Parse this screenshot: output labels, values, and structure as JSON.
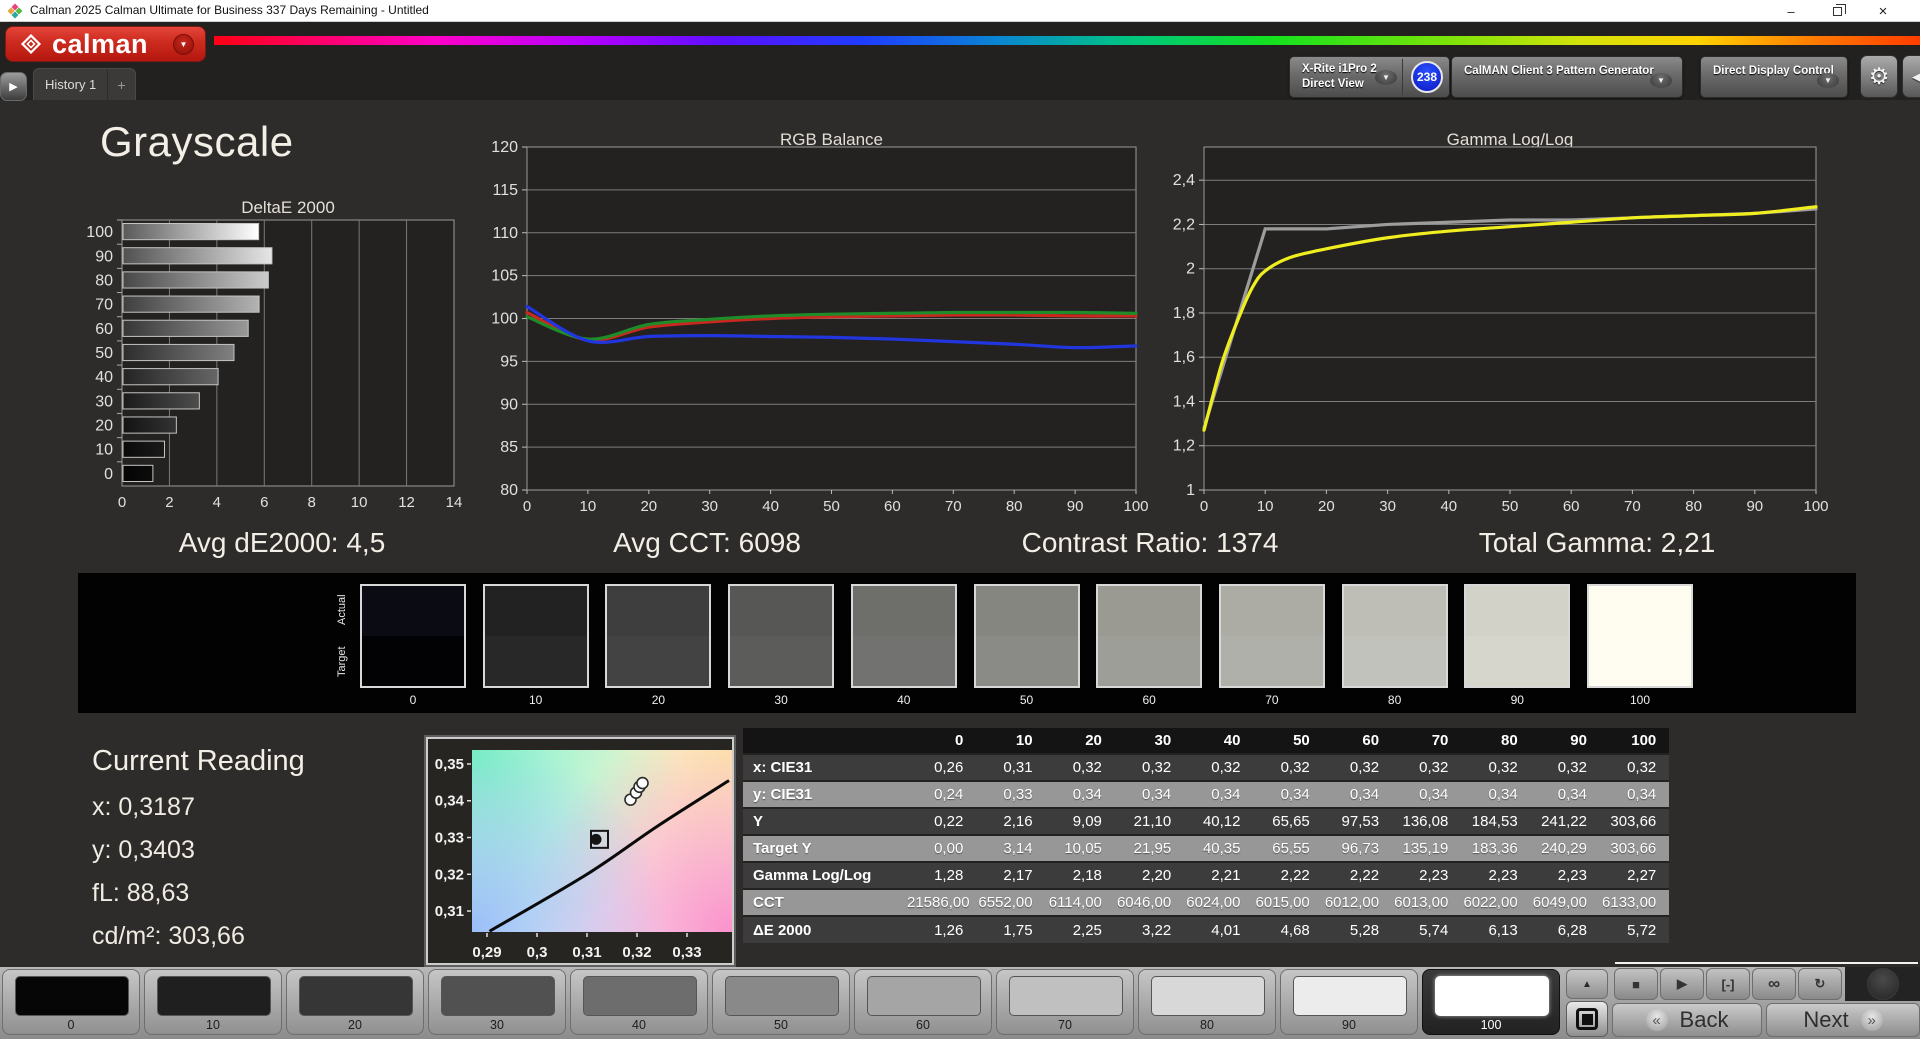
{
  "window": {
    "title": "Calman 2025 Calman Ultimate for Business 337 Days Remaining  - Untitled",
    "controls": {
      "minimize": "–",
      "close": "×"
    }
  },
  "icons": {
    "gear": "⚙",
    "collapse_right": "◀",
    "expand": "▶",
    "dropdown": "▼",
    "up": "▲",
    "back_chevron": "«",
    "next_chevron": "»",
    "plus": "+"
  },
  "header": {
    "logo_text": "calman",
    "tab_label": "History 1",
    "meters": [
      {
        "line1": "X-Rite i1Pro 2",
        "line2": "Direct View",
        "accent": "#35d435",
        "badge": "238"
      },
      {
        "line1": "CalMAN Client 3 Pattern Generator",
        "accent": "#35d435"
      },
      {
        "line1": "Direct Display Control",
        "accent": "#ecec2c"
      }
    ]
  },
  "page": {
    "title": "Grayscale"
  },
  "chart_data": [
    {
      "id": "deltae",
      "type": "bar",
      "orientation": "horizontal",
      "title": "DeltaE 2000",
      "categories": [
        100,
        90,
        80,
        70,
        60,
        50,
        40,
        30,
        20,
        10,
        0
      ],
      "values": [
        5.72,
        6.28,
        6.13,
        5.74,
        5.28,
        4.68,
        4.01,
        3.22,
        2.25,
        1.75,
        1.26
      ],
      "xlim": [
        0,
        14
      ],
      "xticks": [
        0,
        2,
        4,
        6,
        8,
        10,
        12,
        14
      ],
      "grid": "vertical"
    },
    {
      "id": "rgb",
      "type": "line",
      "title": "RGB Balance",
      "x": [
        0,
        10,
        20,
        30,
        40,
        50,
        60,
        70,
        80,
        90,
        100
      ],
      "series": [
        {
          "name": "red-balance",
          "color": "#c8281e",
          "values": [
            100.7,
            97.5,
            99.0,
            99.6,
            100.0,
            100.2,
            100.3,
            100.4,
            100.4,
            100.3,
            100.3
          ]
        },
        {
          "name": "green-balance",
          "color": "#1e8c28",
          "values": [
            100.2,
            97.6,
            99.3,
            99.9,
            100.3,
            100.5,
            100.6,
            100.7,
            100.7,
            100.7,
            100.6
          ]
        },
        {
          "name": "blue-balance",
          "color": "#2236e0",
          "values": [
            101.4,
            97.4,
            97.9,
            98.0,
            97.9,
            97.8,
            97.6,
            97.3,
            97.0,
            96.6,
            96.8
          ]
        }
      ],
      "ylim": [
        80,
        120
      ],
      "yticks": [
        80,
        85,
        90,
        95,
        100,
        105,
        110,
        115,
        120
      ],
      "xticks": [
        0,
        10,
        20,
        30,
        40,
        50,
        60,
        70,
        80,
        90,
        100
      ],
      "grid": "horizontal"
    },
    {
      "id": "gamma",
      "type": "line",
      "title": "Gamma Log/Log",
      "series": [
        {
          "name": "point-gamma",
          "color": "#9c9c9c",
          "smooth": false,
          "x": [
            0,
            10,
            20,
            30,
            40,
            50,
            60,
            70,
            80,
            90,
            100
          ],
          "values": [
            1.28,
            2.18,
            2.18,
            2.2,
            2.21,
            2.22,
            2.22,
            2.23,
            2.24,
            2.25,
            2.27
          ]
        },
        {
          "name": "measured-gamma",
          "color": "#f0ee1e",
          "x": [
            0,
            3,
            6,
            8,
            10,
            14,
            20,
            30,
            40,
            50,
            60,
            70,
            80,
            90,
            100
          ],
          "values": [
            1.27,
            1.58,
            1.8,
            1.92,
            1.99,
            2.05,
            2.09,
            2.14,
            2.17,
            2.19,
            2.21,
            2.23,
            2.24,
            2.25,
            2.28
          ]
        }
      ],
      "xlim": [
        0,
        100
      ],
      "ylim": [
        1,
        2.55
      ],
      "yticks": [
        1,
        1.2,
        1.4,
        1.6,
        1.8,
        2,
        2.2,
        2.4
      ],
      "ylabels": [
        "1",
        "1,2",
        "1,4",
        "1,6",
        "1,8",
        "2",
        "2,2",
        "2,4"
      ],
      "xticks": [
        0,
        10,
        20,
        30,
        40,
        50,
        60,
        70,
        80,
        90,
        100
      ],
      "grid": "horizontal"
    },
    {
      "id": "cie",
      "type": "scatter",
      "title": "CIE xy chromaticity detail",
      "xlim": [
        0.287,
        0.339
      ],
      "ylim": [
        0.3043,
        0.3538
      ],
      "xticks": [
        0.29,
        0.3,
        0.31,
        0.32,
        0.33
      ],
      "xlabels": [
        "0,29",
        "0,3",
        "0,31",
        "0,32",
        "0,33"
      ],
      "yticks": [
        0.31,
        0.32,
        0.33,
        0.34,
        0.35
      ],
      "ylabels": [
        "0,31",
        "0,32",
        "0,33",
        "0,34",
        "0,35"
      ],
      "locus": [
        [
          0.2905,
          0.3045
        ],
        [
          0.31,
          0.32
        ],
        [
          0.324,
          0.333
        ],
        [
          0.3384,
          0.3455
        ]
      ],
      "target": {
        "x": 0.3124,
        "y": 0.3295
      },
      "points": [
        [
          0.3187,
          0.3403
        ],
        [
          0.3198,
          0.3422
        ],
        [
          0.3205,
          0.3438
        ],
        [
          0.3211,
          0.3448
        ]
      ]
    }
  ],
  "summary": {
    "avg_de": "Avg dE2000: 4,5",
    "avg_cct": "Avg CCT: 6098",
    "contrast": "Contrast Ratio: 1374",
    "total_gamma": "Total Gamma: 2,21"
  },
  "swatch_strip": {
    "row_labels": [
      "Actual",
      "Target"
    ],
    "levels": [
      {
        "label": "0",
        "actual": "#0b0b13",
        "target": "#020205"
      },
      {
        "label": "10",
        "actual": "#222222",
        "target": "#282828"
      },
      {
        "label": "20",
        "actual": "#3e3e3e",
        "target": "#434343"
      },
      {
        "label": "30",
        "actual": "#575755",
        "target": "#5c5c5a"
      },
      {
        "label": "40",
        "actual": "#6e6e6a",
        "target": "#727270"
      },
      {
        "label": "50",
        "actual": "#868680",
        "target": "#8a8a86"
      },
      {
        "label": "60",
        "actual": "#9a9a92",
        "target": "#9e9e98"
      },
      {
        "label": "70",
        "actual": "#acaca4",
        "target": "#b0b0aa"
      },
      {
        "label": "80",
        "actual": "#bebeb6",
        "target": "#c2c2bc"
      },
      {
        "label": "90",
        "actual": "#d2d2c8",
        "target": "#d6d6cc"
      },
      {
        "label": "100",
        "actual": "#fffdf0",
        "target": "#fffdf2"
      }
    ]
  },
  "current_reading": {
    "title": "Current Reading",
    "x": "x: 0,3187",
    "y": "y: 0,3403",
    "fl": "fL: 88,63",
    "cdm2": "cd/m²: 303,66"
  },
  "table": {
    "columns": [
      "0",
      "10",
      "20",
      "30",
      "40",
      "50",
      "60",
      "70",
      "80",
      "90",
      "100"
    ],
    "rows": [
      {
        "label": "x: CIE31",
        "shade": "dark",
        "values": [
          "0,26",
          "0,31",
          "0,32",
          "0,32",
          "0,32",
          "0,32",
          "0,32",
          "0,32",
          "0,32",
          "0,32",
          "0,32"
        ]
      },
      {
        "label": "y: CIE31",
        "shade": "light",
        "values": [
          "0,24",
          "0,33",
          "0,34",
          "0,34",
          "0,34",
          "0,34",
          "0,34",
          "0,34",
          "0,34",
          "0,34",
          "0,34"
        ]
      },
      {
        "label": "Y",
        "shade": "dark",
        "values": [
          "0,22",
          "2,16",
          "9,09",
          "21,10",
          "40,12",
          "65,65",
          "97,53",
          "136,08",
          "184,53",
          "241,22",
          "303,66"
        ]
      },
      {
        "label": "Target Y",
        "shade": "light",
        "values": [
          "0,00",
          "3,14",
          "10,05",
          "21,95",
          "40,35",
          "65,55",
          "96,73",
          "135,19",
          "183,36",
          "240,29",
          "303,66"
        ]
      },
      {
        "label": "Gamma Log/Log",
        "shade": "dark",
        "values": [
          "1,28",
          "2,17",
          "2,18",
          "2,20",
          "2,21",
          "2,22",
          "2,22",
          "2,23",
          "2,23",
          "2,23",
          "2,27"
        ]
      },
      {
        "label": "CCT",
        "shade": "light",
        "values": [
          "21586,00",
          "6552,00",
          "6114,00",
          "6046,00",
          "6024,00",
          "6015,00",
          "6012,00",
          "6013,00",
          "6022,00",
          "6049,00",
          "6133,00"
        ]
      },
      {
        "label": "ΔE 2000",
        "shade": "dark",
        "values": [
          "1,26",
          "1,75",
          "2,25",
          "3,22",
          "4,01",
          "4,68",
          "5,28",
          "5,74",
          "6,13",
          "6,28",
          "5,72"
        ]
      }
    ]
  },
  "bottom_bar": {
    "patches": [
      {
        "label": "0",
        "color": "#060606"
      },
      {
        "label": "10",
        "color": "#1f1f1f"
      },
      {
        "label": "20",
        "color": "#363636"
      },
      {
        "label": "30",
        "color": "#515151"
      },
      {
        "label": "40",
        "color": "#6d6d6d"
      },
      {
        "label": "50",
        "color": "#898989"
      },
      {
        "label": "60",
        "color": "#a5a5a5"
      },
      {
        "label": "70",
        "color": "#c0c0c0"
      },
      {
        "label": "80",
        "color": "#d8d8d8"
      },
      {
        "label": "90",
        "color": "#ececec"
      },
      {
        "label": "100",
        "color": "#ffffff",
        "selected": true
      }
    ],
    "transport": [
      {
        "name": "stop",
        "glyph": "■"
      },
      {
        "name": "play",
        "glyph": "▶"
      },
      {
        "name": "single-measure",
        "glyph": "[-]"
      },
      {
        "name": "continuous-measure",
        "glyph": "∞"
      },
      {
        "name": "refresh",
        "glyph": "↻"
      }
    ],
    "back_label": "Back",
    "next_label": "Next"
  }
}
